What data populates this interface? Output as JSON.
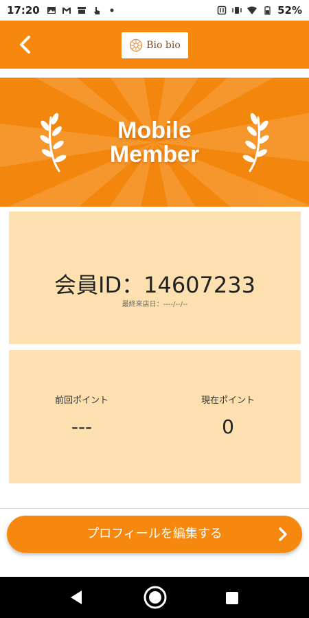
{
  "status_bar": {
    "time": "17:20",
    "battery": "52%",
    "icons": [
      "image-icon",
      "gmail-icon",
      "store-icon",
      "touch-icon",
      "dot-icon"
    ],
    "right_icons": [
      "nfc-icon",
      "vibrate-icon",
      "wifi-icon",
      "battery-icon"
    ]
  },
  "header": {
    "logo_text": "Bio bio",
    "accent": "#f6870f"
  },
  "banner": {
    "title_line1": "Mobile",
    "title_line2": "Member"
  },
  "member": {
    "id_text": "会員ID：14607233",
    "last_visit": "最終来店日：----/--/--"
  },
  "points": {
    "previous_label": "前回ポイント",
    "previous_value": "---",
    "current_label": "現在ポイント",
    "current_value": "0"
  },
  "actions": {
    "edit_profile_label": "プロフィールを編集する"
  }
}
